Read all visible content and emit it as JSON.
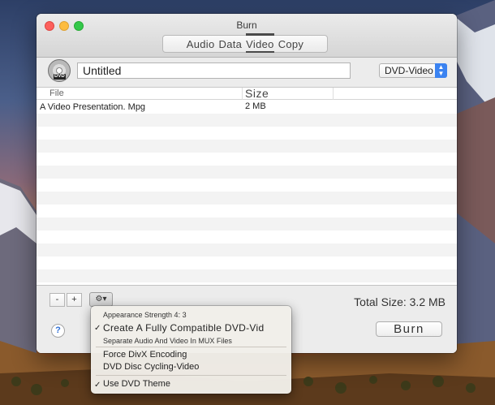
{
  "window": {
    "title": "Burn",
    "tabs": [
      {
        "label": "Audio",
        "active": false
      },
      {
        "label": "Data",
        "active": false
      },
      {
        "label": "Video",
        "active": true
      },
      {
        "label": "Copy",
        "active": false
      }
    ]
  },
  "disc": {
    "label": "DVD"
  },
  "name_field": {
    "value": "Untitled"
  },
  "format_select": {
    "value": "DVD-Video"
  },
  "table": {
    "columns": [
      "File",
      "Size"
    ],
    "rows": [
      {
        "file": "A Video Presentation. Mpg",
        "size": "2 MB"
      }
    ]
  },
  "bottom": {
    "remove_label": "-",
    "add_label": "+",
    "gear_label": "⚙▾",
    "total_size": "Total Size: 3.2 MB"
  },
  "footer": {
    "help_label": "?",
    "burn_label": "Burn"
  },
  "menu": {
    "items": [
      {
        "label": "Appearance Strength 4: 3",
        "checked": false
      },
      {
        "label": "Create A Fully Compatible DVD-Vid",
        "checked": true
      },
      {
        "label": "Separate Audio And Video In MUX Files",
        "checked": false
      },
      {
        "label": "Force DivX Encoding",
        "checked": false
      },
      {
        "label": "DVD Disc Cycling-Video",
        "checked": false
      },
      {
        "label": "Use DVD Theme",
        "checked": true
      }
    ],
    "check_glyph": "✓"
  },
  "colors": {
    "accent": "#3b83f1",
    "close": "#fc605c",
    "minimize": "#fdbc40",
    "zoom": "#34c84a"
  }
}
